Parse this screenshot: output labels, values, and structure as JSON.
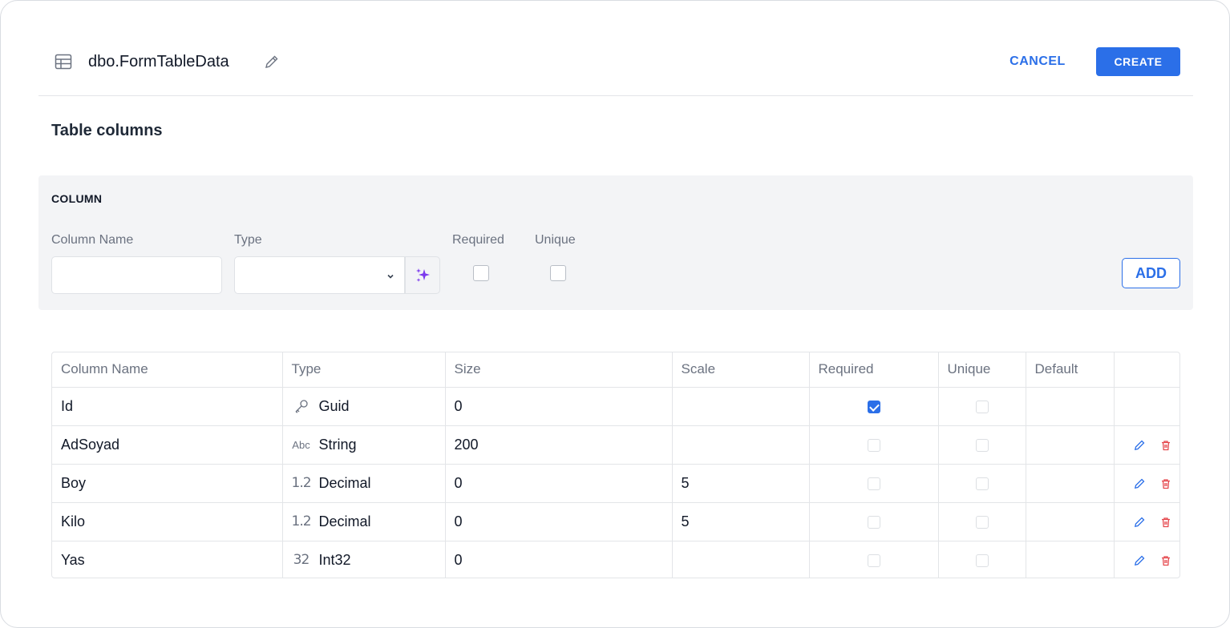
{
  "header": {
    "title": "dbo.FormTableData",
    "cancel_label": "CANCEL",
    "create_label": "CREATE"
  },
  "section_title": "Table columns",
  "column_form": {
    "heading": "COLUMN",
    "labels": {
      "column_name": "Column Name",
      "type": "Type",
      "required": "Required",
      "unique": "Unique"
    },
    "column_name_value": "",
    "type_value": "",
    "required_checked": false,
    "unique_checked": false,
    "add_label": "ADD"
  },
  "table": {
    "headers": [
      "Column Name",
      "Type",
      "Size",
      "Scale",
      "Required",
      "Unique",
      "Default",
      ""
    ],
    "rows": [
      {
        "name": "Id",
        "type_icon": "key-icon",
        "type": "Guid",
        "size": "0",
        "scale": "",
        "required": true,
        "unique": false,
        "default": "",
        "editable": false
      },
      {
        "name": "AdSoyad",
        "type_icon": "text-type-icon",
        "type_glyph": "Abc",
        "type": "String",
        "size": "200",
        "scale": "",
        "required": false,
        "unique": false,
        "default": "",
        "editable": true
      },
      {
        "name": "Boy",
        "type_icon": "decimal-type-icon",
        "type_glyph": "1.2",
        "type": "Decimal",
        "size": "0",
        "scale": "5",
        "required": false,
        "unique": false,
        "default": "",
        "editable": true
      },
      {
        "name": "Kilo",
        "type_icon": "decimal-type-icon",
        "type_glyph": "1.2",
        "type": "Decimal",
        "size": "0",
        "scale": "5",
        "required": false,
        "unique": false,
        "default": "",
        "editable": true
      },
      {
        "name": "Yas",
        "type_icon": "integer-type-icon",
        "type_glyph": "32",
        "type": "Int32",
        "size": "0",
        "scale": "",
        "required": false,
        "unique": false,
        "default": "",
        "editable": true
      }
    ]
  },
  "colors": {
    "accent": "#2b6fe8",
    "delete": "#e5484d",
    "magic": "#7c3aed"
  }
}
